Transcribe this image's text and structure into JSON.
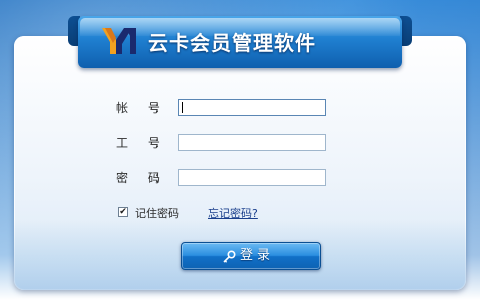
{
  "app": {
    "title": "云卡会员管理软件"
  },
  "form": {
    "account_label": "帐  号",
    "job_no_label": "工  号",
    "password_label": "密  码",
    "colon": "：",
    "account_value": "",
    "job_no_value": "",
    "password_value": ""
  },
  "options": {
    "remember_password_label": "记住密码",
    "remember_password_checked": true,
    "check_glyph": "✔",
    "forgot_password_link": "忘记密码?"
  },
  "actions": {
    "login_label": "登录",
    "login_icon": "key-icon"
  },
  "colors": {
    "background": "#2b78c8",
    "banner": "#1f7fd0",
    "button": "#1170c8",
    "link": "#1a3f8c"
  }
}
